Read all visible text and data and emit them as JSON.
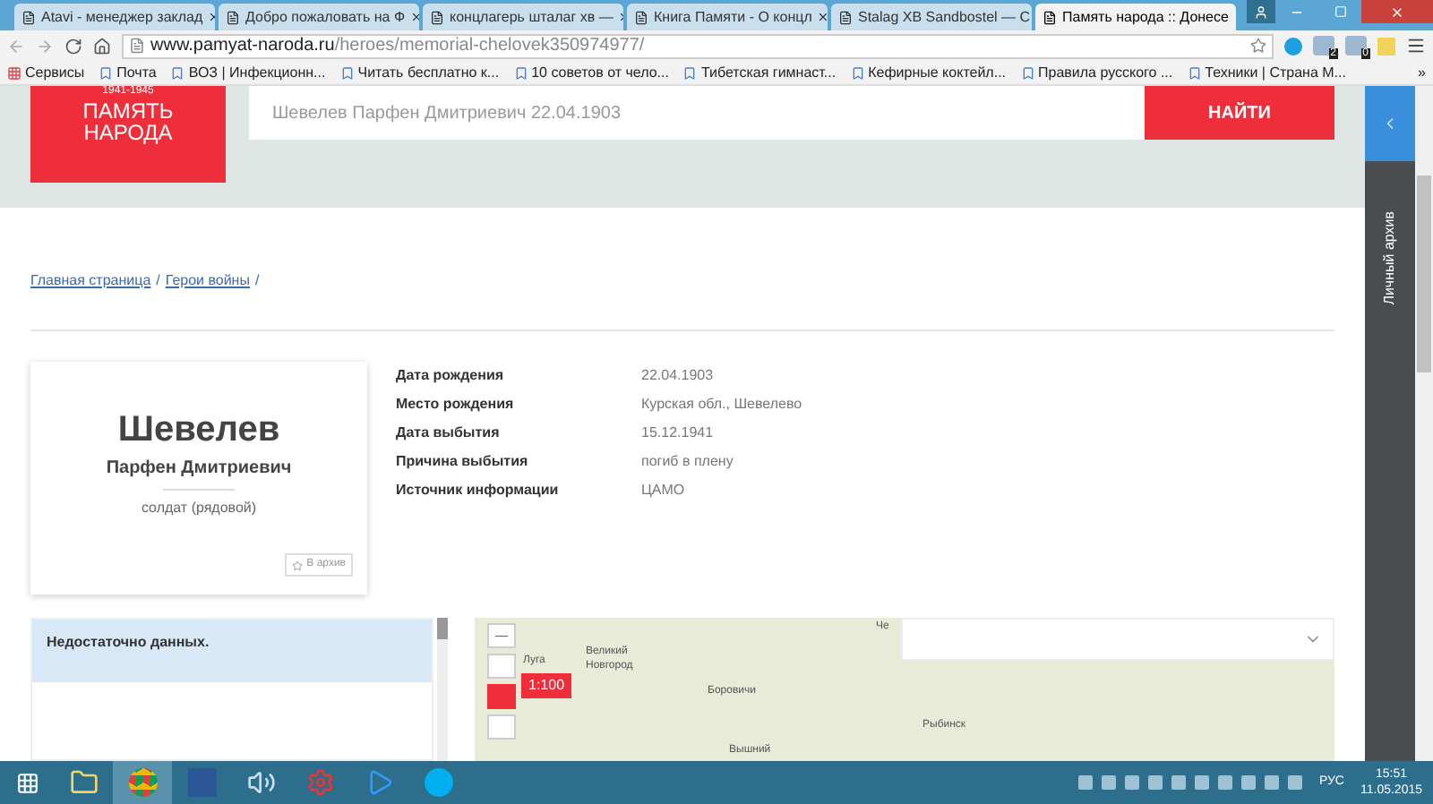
{
  "browser": {
    "tabs": [
      {
        "title": "Atavi - менеджер заклад",
        "selected": false
      },
      {
        "title": "Добро пожаловать на Ф",
        "selected": false
      },
      {
        "title": "концлагерь шталаг хв —",
        "selected": false
      },
      {
        "title": "Книга Памяти - О концл",
        "selected": false
      },
      {
        "title": "Stalag XB Sandbostel — С",
        "selected": false
      },
      {
        "title": "Память народа :: Донесе",
        "selected": true
      }
    ],
    "url_host": "www.pamyat-naroda.ru",
    "url_path": "/heroes/memorial-chelovek350974977/",
    "extension_badges": [
      "2",
      "0"
    ],
    "bookmarks": [
      "Сервисы",
      "Почта",
      "ВОЗ | Инфекционн...",
      "Читать бесплатно к...",
      "10 советов от чело...",
      "Тибетская гимнаст...",
      "Кефирные коктейл...",
      "Правила русского ...",
      "Техники | Страна М..."
    ],
    "bookmarks_more": "»"
  },
  "site": {
    "logo": {
      "years": "1941-1945",
      "line1": "ПАМЯТЬ",
      "line2": "НАРОДА"
    },
    "search": {
      "value": "Шевелев Парфен Дмитриевич 22.04.1903",
      "button": "НАЙТИ"
    },
    "side_panel": {
      "label": "Личный архив"
    },
    "breadcrumbs": [
      "Главная страница",
      "Герои войны"
    ],
    "breadcrumb_separator": "/",
    "person": {
      "surname": "Шевелев",
      "name": "Парфен Дмитриевич",
      "rank": "солдат (рядовой)",
      "archive_button": "В архив"
    },
    "facts": [
      {
        "label": "Дата рождения",
        "value": "22.04.1903"
      },
      {
        "label": "Место рождения",
        "value": "Курская обл., Шевелево"
      },
      {
        "label": "Дата выбытия",
        "value": "15.12.1941"
      },
      {
        "label": "Причина выбытия",
        "value": "погиб в плену"
      },
      {
        "label": "Источник информации",
        "value": "ЦАМО"
      }
    ],
    "notice": "Недостаточно данных.",
    "map": {
      "zoom_out": "—",
      "scale": "1:100",
      "places": [
        {
          "name": "Че"
        },
        {
          "name": "Луга"
        },
        {
          "name": "Великий Новгород"
        },
        {
          "name": "Боровичи"
        },
        {
          "name": "Рыбинск"
        },
        {
          "name": "Вышний"
        }
      ]
    }
  },
  "taskbar": {
    "apps": [
      {
        "kind": "explorer",
        "selected": false
      },
      {
        "kind": "chrome",
        "selected": true
      },
      {
        "kind": "word",
        "selected": false
      },
      {
        "kind": "audio",
        "selected": false
      },
      {
        "kind": "gear",
        "selected": false
      },
      {
        "kind": "player",
        "selected": false
      },
      {
        "kind": "skype",
        "selected": false
      }
    ],
    "language": "РУС",
    "time": "15:51",
    "date": "11.05.2015"
  }
}
